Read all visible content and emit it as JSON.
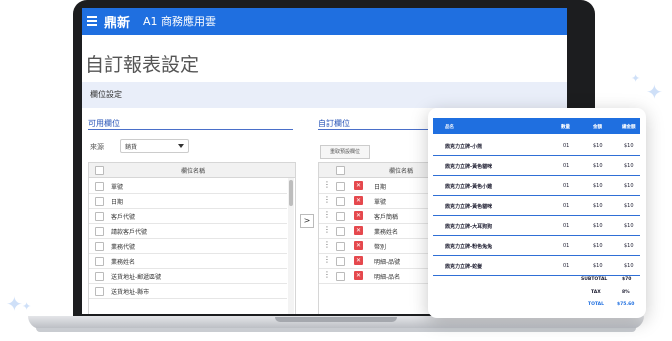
{
  "app": {
    "brand": "鼎新",
    "brand_sub": "A1 商務應用雲",
    "page_title": "自訂報表設定"
  },
  "section": {
    "title": "欄位設定"
  },
  "available": {
    "title": "可用欄位",
    "source_label": "來源",
    "source_value": "銷貨",
    "column_header": "欄位名稱",
    "items": [
      "單號",
      "日期",
      "客戶代號",
      "請款客戶代號",
      "業務代號",
      "業務姓名",
      "送貨地址-郵遞區號",
      "送貨地址-縣市"
    ]
  },
  "custom": {
    "title": "自訂欄位",
    "reset_label": "重取預設欄位",
    "column_header": "欄位名稱",
    "items": [
      "日期",
      "單號",
      "客戶簡稱",
      "業務姓名",
      "幣別",
      "明細-品號",
      "明細-品名"
    ]
  },
  "move_label": ">",
  "invoice": {
    "headers": [
      "品名",
      "數量",
      "金額",
      "總金額"
    ],
    "rows": [
      {
        "name": "鼎克力立牌-小熊",
        "qty": "01",
        "price": "$10",
        "total": "$10"
      },
      {
        "name": "鼎克力立牌-黃色貓咪",
        "qty": "01",
        "price": "$10",
        "total": "$10"
      },
      {
        "name": "鼎克力立牌-黃色小雞",
        "qty": "01",
        "price": "$10",
        "total": "$10"
      },
      {
        "name": "鼎克力立牌-黃色貓咪",
        "qty": "01",
        "price": "$10",
        "total": "$10"
      },
      {
        "name": "鼎克力立牌-大耳狗狗",
        "qty": "01",
        "price": "$10",
        "total": "$10"
      },
      {
        "name": "鼎克力立牌-粉色兔兔",
        "qty": "01",
        "price": "$10",
        "total": "$10"
      },
      {
        "name": "鼎克力立牌-蛇髮",
        "qty": "01",
        "price": "$10",
        "total": "$10"
      }
    ],
    "subtotal_label": "SUBTOTAL",
    "subtotal": "$70",
    "tax_label": "TAX",
    "tax": "8%",
    "total_label": "TOTAL",
    "total": "$75.60"
  },
  "colors": {
    "brand_blue": "#1f6fe0",
    "delete_red": "#e5484d",
    "spark": "#cfe0f8"
  },
  "icons": [
    "hamburger-menu-icon",
    "chevron-down-icon",
    "checkbox-icon",
    "drag-handle-icon",
    "delete-icon",
    "sparkle-icon"
  ]
}
